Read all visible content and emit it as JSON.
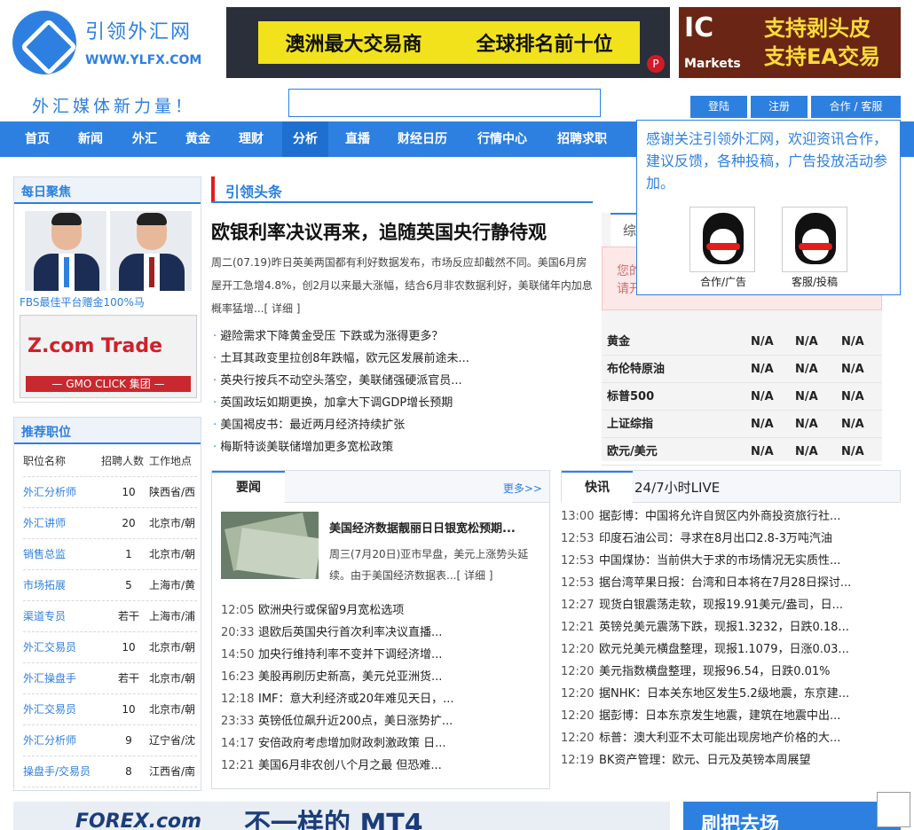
{
  "logo": {
    "cn": "引领外汇网",
    "en": "WWW.YLFX.COM"
  },
  "banners": {
    "b1_left": "澳洲最大交易商",
    "b1_right": "全球排名前十位",
    "b1_badge": "P",
    "b2_ic": "IC",
    "b2_markets": "Markets",
    "b2_line1": "支持剥头皮",
    "b2_line2": "支持EA交易"
  },
  "slogan": "外汇媒体新力量！",
  "search": {
    "placeholder": ""
  },
  "top_buttons": {
    "login": "登陆",
    "register": "注册",
    "contact": "合作 / 客服"
  },
  "nav": [
    "首页",
    "新闻",
    "外汇",
    "黄金",
    "理财",
    "分析",
    "直播",
    "财经日历",
    "行情中心",
    "招聘求职"
  ],
  "popup": {
    "text": "感谢关注引领外汇网，欢迎资讯合作，建议反馈，各种投稿，广告投放活动参加。",
    "qq1": "合作/广告",
    "qq2": "客服/投稿"
  },
  "daily": {
    "title": "每日聚焦",
    "caption": "FBS最佳平台赠金100%马",
    "zcom": "Z.com Trade",
    "gmo": "— GMO CLICK 集团 —"
  },
  "jobs": {
    "title": "推荐职位",
    "headers": [
      "职位名称",
      "招聘人数",
      "工作地点"
    ],
    "rows": [
      [
        "外汇分析师",
        "10",
        "陕西省/西"
      ],
      [
        "外汇讲师",
        "20",
        "北京市/朝"
      ],
      [
        "销售总监",
        "1",
        "北京市/朝"
      ],
      [
        "市场拓展",
        "5",
        "上海市/黄"
      ],
      [
        "渠道专员",
        "若干",
        "上海市/浦"
      ],
      [
        "外汇交易员",
        "10",
        "北京市/朝"
      ],
      [
        "外汇操盘手",
        "若干",
        "北京市/朝"
      ],
      [
        "外汇交易员",
        "10",
        "北京市/朝"
      ],
      [
        "外汇分析师",
        "9",
        "辽宁省/沈"
      ],
      [
        "操盘手/交易员",
        "8",
        "江西省/南"
      ]
    ]
  },
  "headline": {
    "section": "引领头条",
    "title": "欧银利率决议再来，追随英国央行静待观",
    "summary": "周二(07.19)昨日英美两国都有利好数据发布，市场反应却截然不同。美国6月房屋开工急增4.8%，创2月以来最大涨幅，结合6月非农数据利好，美联储年内加息概率猛增...",
    "detail": "[ 详细 ]",
    "items": [
      "避险需求下降黄金受压 下跌或为涨得更多？",
      "土耳其政变里拉创8年跌幅，欧元区发展前途未...",
      "英央行按兵不动空头落空，美联储强硬派官员...",
      "英国政坛如期更换，加拿大下调GDP增长预期",
      "美国褐皮书：最近两月经济持续扩张",
      "梅斯特谈美联储增加更多宽松政策"
    ]
  },
  "market": {
    "tab": "综",
    "notice1": "您的",
    "notice2": "请开",
    "rows": [
      [
        "黄金",
        "N/A",
        "N/A",
        "N/A"
      ],
      [
        "布伦特原油",
        "N/A",
        "N/A",
        "N/A"
      ],
      [
        "标普500",
        "N/A",
        "N/A",
        "N/A"
      ],
      [
        "上证综指",
        "N/A",
        "N/A",
        "N/A"
      ],
      [
        "欧元/美元",
        "N/A",
        "N/A",
        "N/A"
      ]
    ]
  },
  "news": {
    "tab": "要闻",
    "more": "更多>>",
    "feature_title": "美国经济数据靓丽日日银宽松预期...",
    "feature_summary": "周三(7月20日)亚市早盘，美元上涨势头延续。由于美国经济数据表...",
    "detail": "[ 详细 ]",
    "items": [
      [
        "12:05",
        "欧洲央行或保留9月宽松选项"
      ],
      [
        "20:33",
        "退欧后英国央行首次利率决议直播..."
      ],
      [
        "14:50",
        "加央行维持利率不变并下调经济增..."
      ],
      [
        "16:23",
        "美股再刷历史新高，美元兑亚洲货..."
      ],
      [
        "12:18",
        "IMF：意大利经济或20年难见天日，..."
      ],
      [
        "23:33",
        "英镑低位飙升近200点，美日涨势扩..."
      ],
      [
        "14:17",
        "安倍政府考虑增加财政刺激政策 日..."
      ],
      [
        "12:21",
        "美国6月非农创八个月之最 但恐难..."
      ]
    ]
  },
  "flash": {
    "tab": "快讯",
    "live": "24/7小时LIVE",
    "items": [
      [
        "13:00",
        "据彭博：中国将允许自贸区内外商投资旅行社..."
      ],
      [
        "12:53",
        "印度石油公司：寻求在8月出口2.8-3万吨汽油"
      ],
      [
        "12:53",
        "中国煤协：当前供大于求的市场情况无实质性..."
      ],
      [
        "12:53",
        "据台湾苹果日报：台湾和日本将在7月28日探讨..."
      ],
      [
        "12:27",
        "现货白银震荡走软，现报19.91美元/盎司，日..."
      ],
      [
        "12:21",
        "英镑兑美元震荡下跌，现报1.3232，日跌0.18..."
      ],
      [
        "12:20",
        "欧元兑美元横盘整理，现报1.1079，日涨0.03..."
      ],
      [
        "12:20",
        "美元指数横盘整理，现报96.54，日跌0.01%"
      ],
      [
        "12:20",
        "据NHK：日本关东地区发生5.2级地震，东京建..."
      ],
      [
        "12:20",
        "据彭博：日本东京发生地震，建筑在地震中出..."
      ],
      [
        "12:20",
        "标普：澳大利亚不太可能出现房地产价格的大..."
      ],
      [
        "12:19",
        "BK资产管理：欧元、日元及英镑本周展望"
      ]
    ]
  },
  "bottom": {
    "forex": "FOREX.com",
    "mt4": "不一样的 MT4",
    "right": "刷把去场"
  }
}
